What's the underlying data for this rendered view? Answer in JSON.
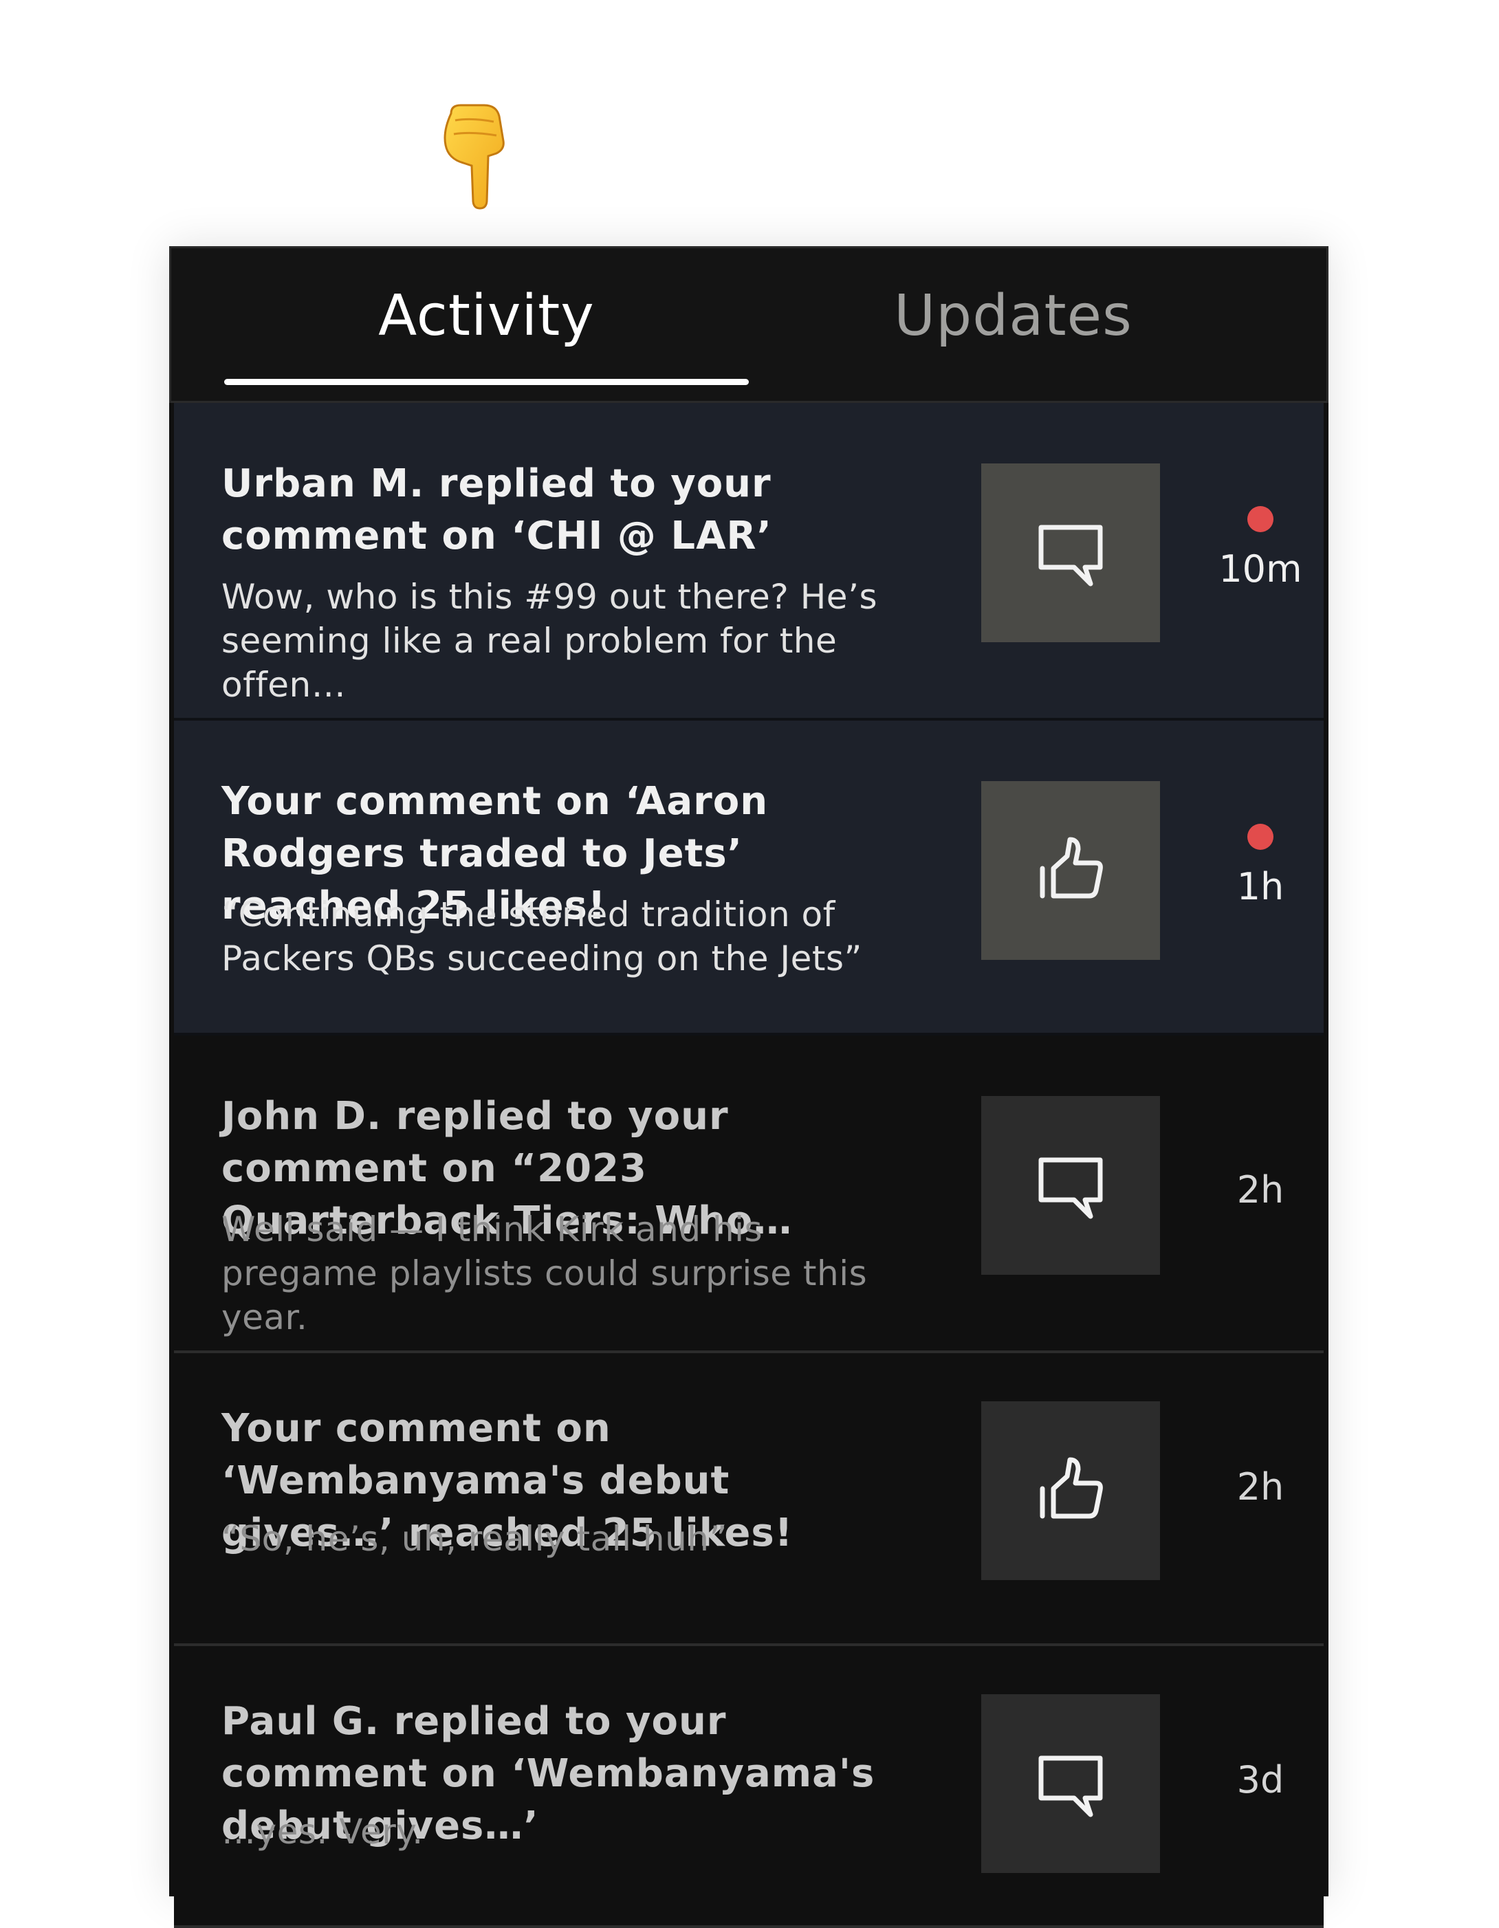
{
  "tabs": [
    {
      "label": "Activity",
      "active": true
    },
    {
      "label": "Updates",
      "active": false
    }
  ],
  "colors": {
    "unread_dot": "#e24c4c",
    "unread_row_bg": "#1d212a",
    "read_row_bg": "#101010"
  },
  "notifications": [
    {
      "title": "Urban M. replied to your comment on ‘CHI @ LAR’",
      "body": "Wow, who is this #99 out there? He’s seeming like a real problem for the offen…",
      "icon": "comment-icon",
      "time": "10m",
      "unread": true
    },
    {
      "title": "Your comment on ‘Aaron Rodgers traded to Jets’ reached 25 likes!",
      "body": "“Continuing the storied tradition of Packers QBs succeeding on the Jets”",
      "icon": "thumbs-up-icon",
      "time": "1h",
      "unread": true
    },
    {
      "title": "John D. replied to your comment on “2023 Quarterback Tiers: Who…",
      "body": "Well said — I think Kirk and his pregame playlists could surprise this year.",
      "icon": "comment-icon",
      "time": "2h",
      "unread": false
    },
    {
      "title": "Your comment on ‘Wembanyama's debut gives…’ reached 25 likes!",
      "body": "“So, he’s, uh, really tall huh”",
      "icon": "thumbs-up-icon",
      "time": "2h",
      "unread": false
    },
    {
      "title": "Paul G. replied to your comment on ‘Wembanyama's debut gives…’",
      "body": "…yes. Very.",
      "icon": "comment-icon",
      "time": "3d",
      "unread": false
    }
  ]
}
